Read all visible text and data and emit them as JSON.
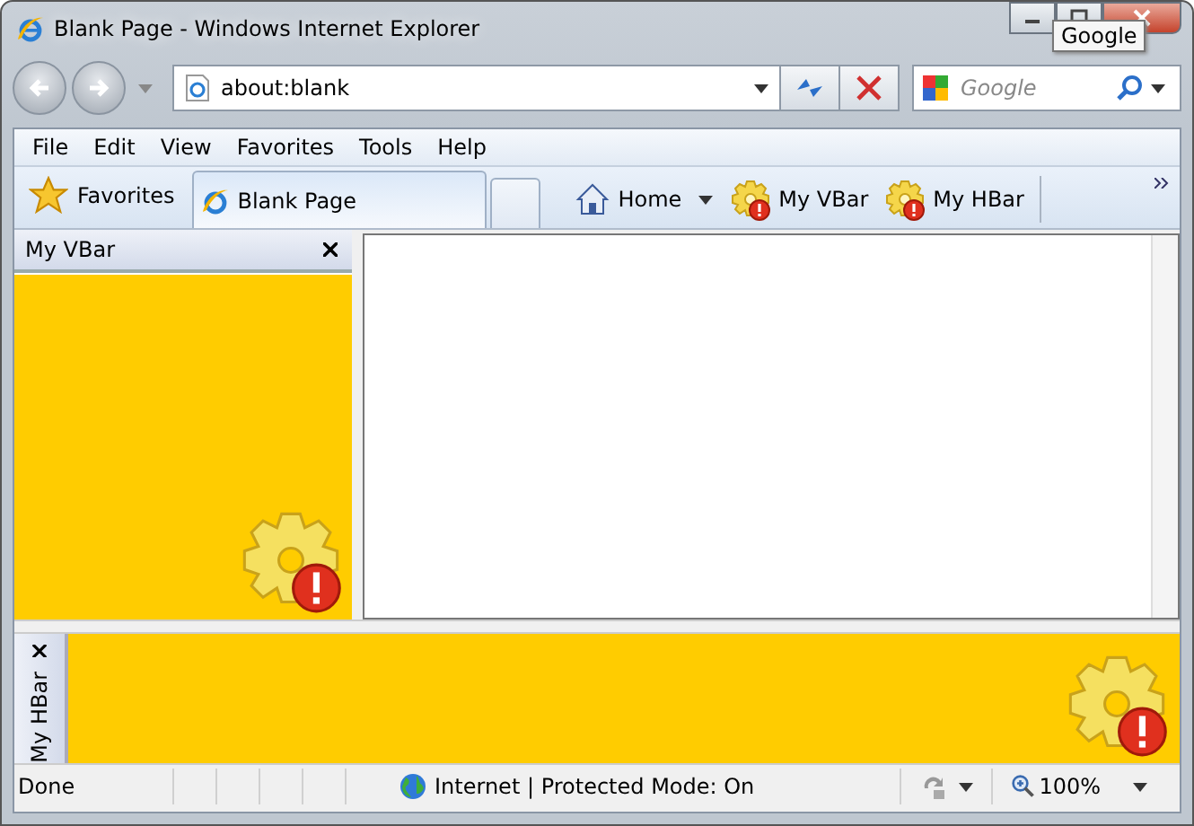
{
  "window": {
    "title": "Blank Page - Windows Internet Explorer",
    "tooltip": "Google"
  },
  "address_bar": {
    "value": "about:blank"
  },
  "search": {
    "placeholder": "Google"
  },
  "menu": [
    "File",
    "Edit",
    "View",
    "Favorites",
    "Tools",
    "Help"
  ],
  "favorites_label": "Favorites",
  "tabs": [
    {
      "label": "Blank Page",
      "selected": true
    }
  ],
  "command_bar": [
    {
      "label": "Home",
      "kind": "home"
    },
    {
      "label": "My VBar",
      "kind": "gear"
    },
    {
      "label": "My HBar",
      "kind": "gear"
    }
  ],
  "vbar": {
    "title": "My VBar"
  },
  "hbar": {
    "title": "My HBar"
  },
  "status_bar": {
    "text": "Done",
    "zone": "Internet | Protected Mode: On",
    "zoom": "100%"
  }
}
